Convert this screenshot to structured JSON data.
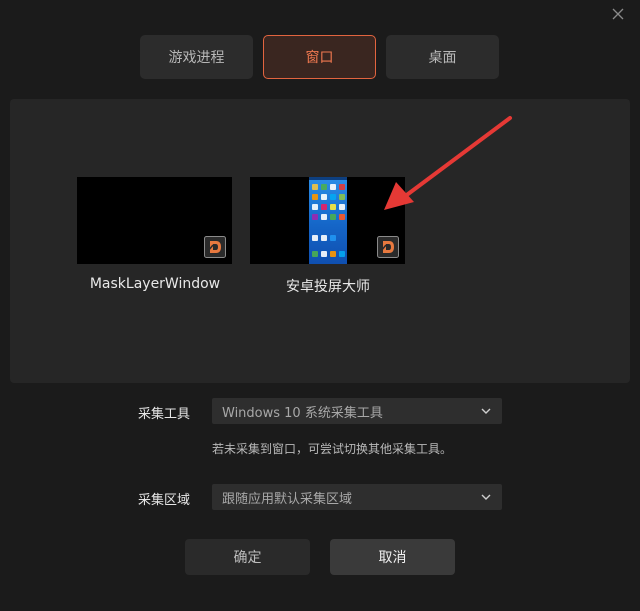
{
  "tabs": [
    {
      "label": "游戏进程",
      "active": false
    },
    {
      "label": "窗口",
      "active": true
    },
    {
      "label": "桌面",
      "active": false
    }
  ],
  "windows": [
    {
      "label": "MaskLayerWindow",
      "badge_icon": "app-logo-d-icon"
    },
    {
      "label": "安卓投屏大师",
      "badge_icon": "app-logo-d-icon"
    }
  ],
  "capture_tool": {
    "label": "采集工具",
    "value": "Windows 10 系统采集工具",
    "hint": "若未采集到窗口，可尝试切换其他采集工具。"
  },
  "capture_area": {
    "label": "采集区域",
    "value": "跟随应用默认采集区域"
  },
  "buttons": {
    "ok_label": "确定",
    "cancel_label": "取消"
  },
  "colors": {
    "accent": "#e2643f",
    "annotation_arrow": "#e53935",
    "background": "#1b1b1b",
    "panel": "#262626"
  }
}
